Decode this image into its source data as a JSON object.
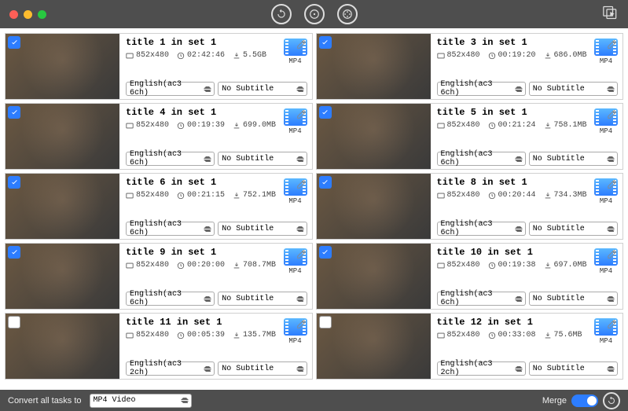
{
  "footer": {
    "convert_label": "Convert all tasks to",
    "convert_format": "MP4 Video",
    "merge_label": "Merge"
  },
  "format_label": "MP4",
  "items": [
    {
      "title": "title 1 in set 1",
      "res": "852x480",
      "dur": "02:42:46",
      "size": "5.5GB",
      "audio": "English(ac3 6ch)",
      "sub": "No Subtitle",
      "checked": true
    },
    {
      "title": "title 3 in set 1",
      "res": "852x480",
      "dur": "00:19:20",
      "size": "686.0MB",
      "audio": "English(ac3 6ch)",
      "sub": "No Subtitle",
      "checked": true
    },
    {
      "title": "title 4 in set 1",
      "res": "852x480",
      "dur": "00:19:39",
      "size": "699.0MB",
      "audio": "English(ac3 6ch)",
      "sub": "No Subtitle",
      "checked": true
    },
    {
      "title": "title 5 in set 1",
      "res": "852x480",
      "dur": "00:21:24",
      "size": "758.1MB",
      "audio": "English(ac3 6ch)",
      "sub": "No Subtitle",
      "checked": true
    },
    {
      "title": "title 6 in set 1",
      "res": "852x480",
      "dur": "00:21:15",
      "size": "752.1MB",
      "audio": "English(ac3 6ch)",
      "sub": "No Subtitle",
      "checked": true
    },
    {
      "title": "title 8 in set 1",
      "res": "852x480",
      "dur": "00:20:44",
      "size": "734.3MB",
      "audio": "English(ac3 6ch)",
      "sub": "No Subtitle",
      "checked": true
    },
    {
      "title": "title 9 in set 1",
      "res": "852x480",
      "dur": "00:20:00",
      "size": "708.7MB",
      "audio": "English(ac3 6ch)",
      "sub": "No Subtitle",
      "checked": true
    },
    {
      "title": "title 10 in set 1",
      "res": "852x480",
      "dur": "00:19:38",
      "size": "697.0MB",
      "audio": "English(ac3 6ch)",
      "sub": "No Subtitle",
      "checked": true
    },
    {
      "title": "title 11 in set 1",
      "res": "852x480",
      "dur": "00:05:39",
      "size": "135.7MB",
      "audio": "English(ac3 2ch)",
      "sub": "No Subtitle",
      "checked": false
    },
    {
      "title": "title 12 in set 1",
      "res": "852x480",
      "dur": "00:33:08",
      "size": "75.6MB",
      "audio": "English(ac3 2ch)",
      "sub": "No Subtitle",
      "checked": false
    }
  ]
}
